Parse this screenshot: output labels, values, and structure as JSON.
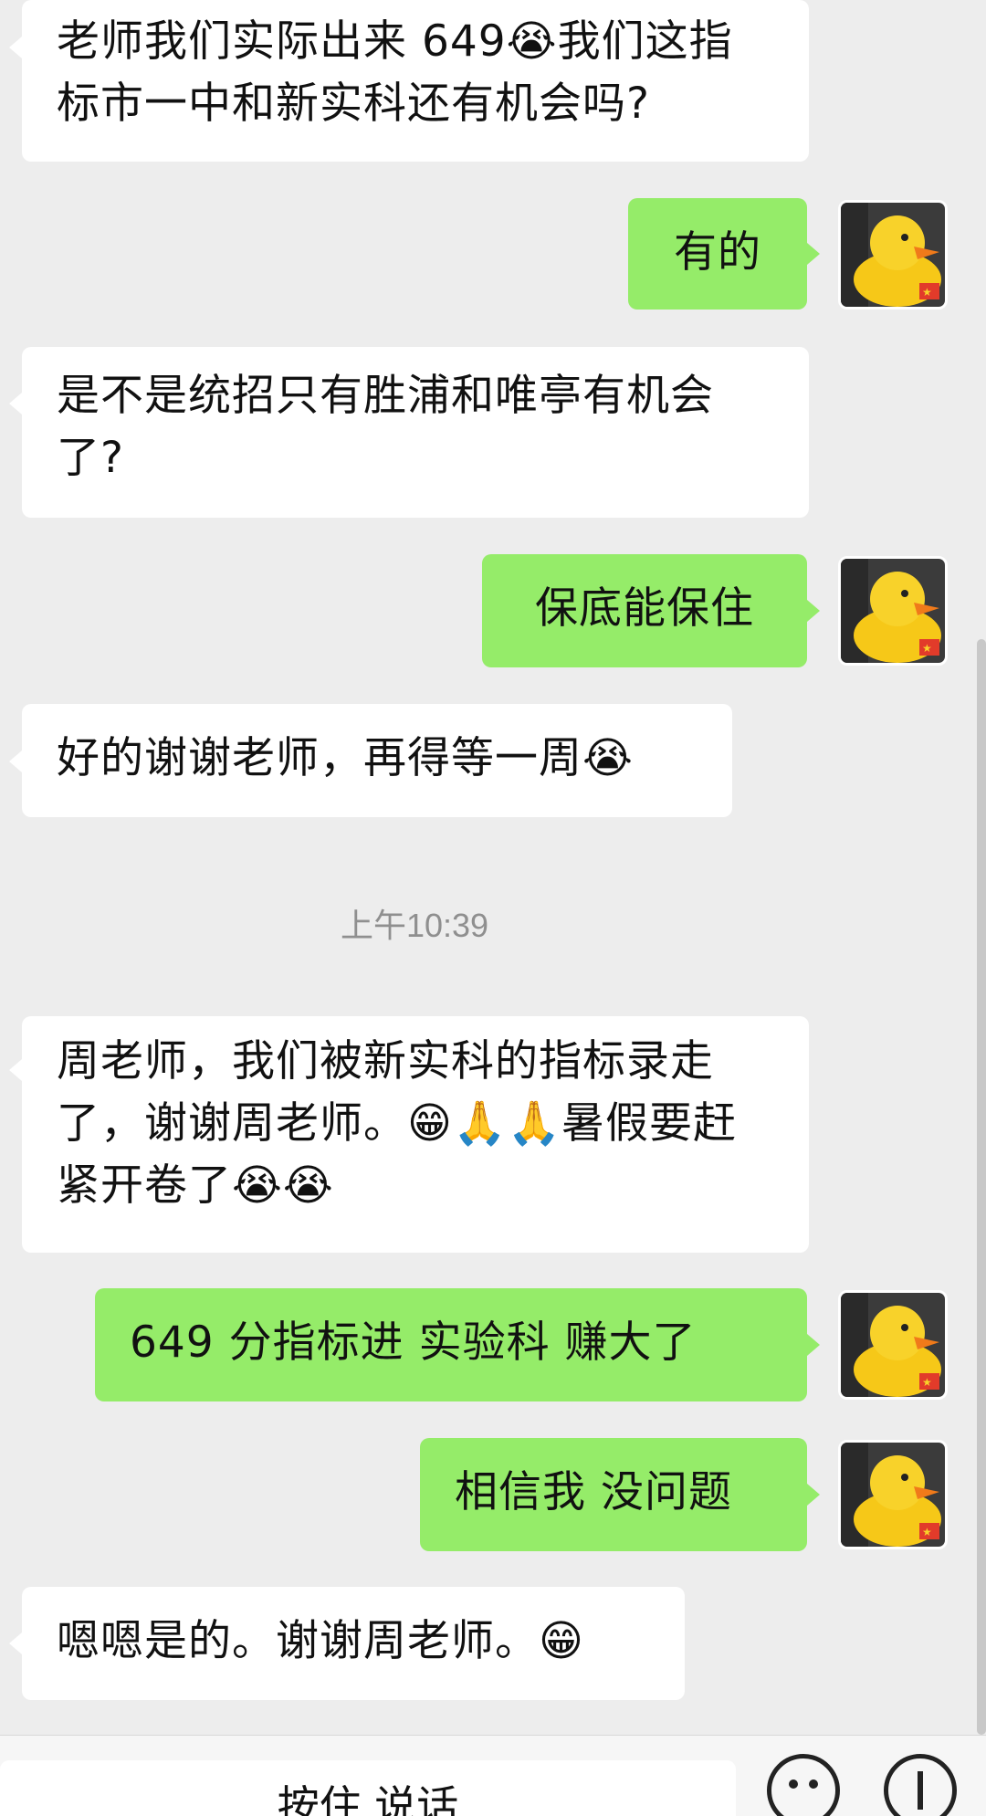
{
  "messages": [
    {
      "side": "in",
      "text": "老师我们实际出来 649😭我们这指标市一中和新实科还有机会吗?"
    },
    {
      "side": "out",
      "text": "有的"
    },
    {
      "side": "in",
      "text": "是不是统招只有胜浦和唯亭有机会了?"
    },
    {
      "side": "out",
      "text": "保底能保住"
    },
    {
      "side": "in",
      "text": "好的谢谢老师，再得等一周😭"
    },
    {
      "side": "in",
      "text": "周老师，我们被新实科的指标录走了，谢谢周老师。😁🙏🙏暑假要赶紧开卷了😭😭"
    },
    {
      "side": "out",
      "text": "649 分指标进  实验科 赚大了"
    },
    {
      "side": "out",
      "text": "相信我 没问题"
    },
    {
      "side": "in",
      "text": "嗯嗯是的。谢谢周老师。😁"
    }
  ],
  "timestamp": "上午10:39",
  "bottom": {
    "hold_to_talk": "按住 说话",
    "emoji_icon": "smiley-icon",
    "add_icon": "plus-circle-icon"
  },
  "colors": {
    "background": "#ededed",
    "incoming_bubble": "#ffffff",
    "outgoing_bubble": "#95ec69"
  }
}
